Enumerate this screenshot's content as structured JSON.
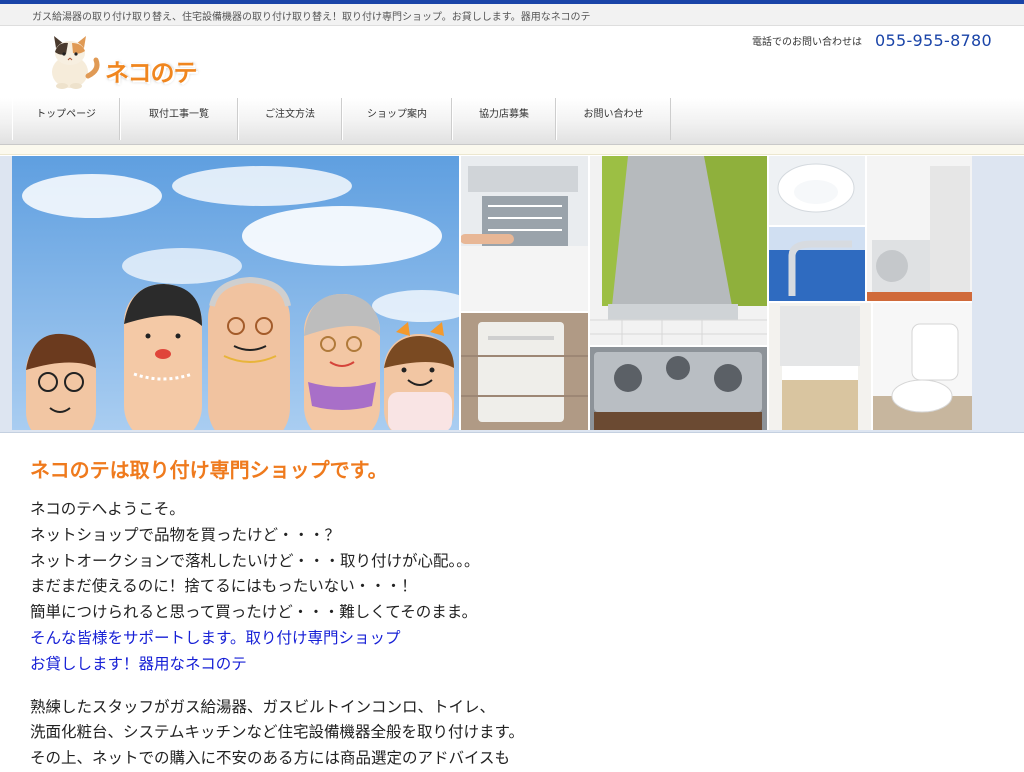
{
  "header": {
    "tagline": "ガス給湯器の取り付け取り替え、住宅設備機器の取り付け取り替え！取り付け専門ショップ。お貸しします。器用なネコのテ",
    "logo_text": "ネコのテ",
    "contact_label": "電話でのお問い合わせは",
    "phone": "055-955-8780"
  },
  "nav": {
    "items": [
      {
        "label": "トップページ"
      },
      {
        "label": "取付工事一覧"
      },
      {
        "label": "ご注文方法"
      },
      {
        "label": "ショップ案内"
      },
      {
        "label": "協力店募集"
      },
      {
        "label": "お問い合わせ"
      }
    ]
  },
  "main": {
    "headline": "ネコのテは取り付け専門ショップです。",
    "intro_lines": [
      "ネコのテへようこそ。",
      "ネットショップで品物を買ったけど・・・？",
      "ネットオークションで落札したいけど・・・取り付けが心配。。。",
      "まだまだ使えるのに！捨てるにはもったいない・・・！",
      "簡単につけられると思って買ったけど・・・難しくてそのまま。"
    ],
    "highlight_lines": [
      "そんな皆様をサポートします。取り付け専門ショップ",
      "お貸しします！器用なネコのテ"
    ],
    "body_lines": [
      "熟練したスタッフがガス給湯器、ガスビルトインコンロ、トイレ、",
      "洗面化粧台、システムキッチンなど住宅設備機器全般を取り付けます。",
      "その上、ネットでの購入に不安のある方には商品選定のアドバイスも"
    ]
  },
  "colors": {
    "accent_blue": "#1a44a8",
    "headline_orange": "#ef7a1d",
    "highlight_blue": "#1720d6"
  }
}
